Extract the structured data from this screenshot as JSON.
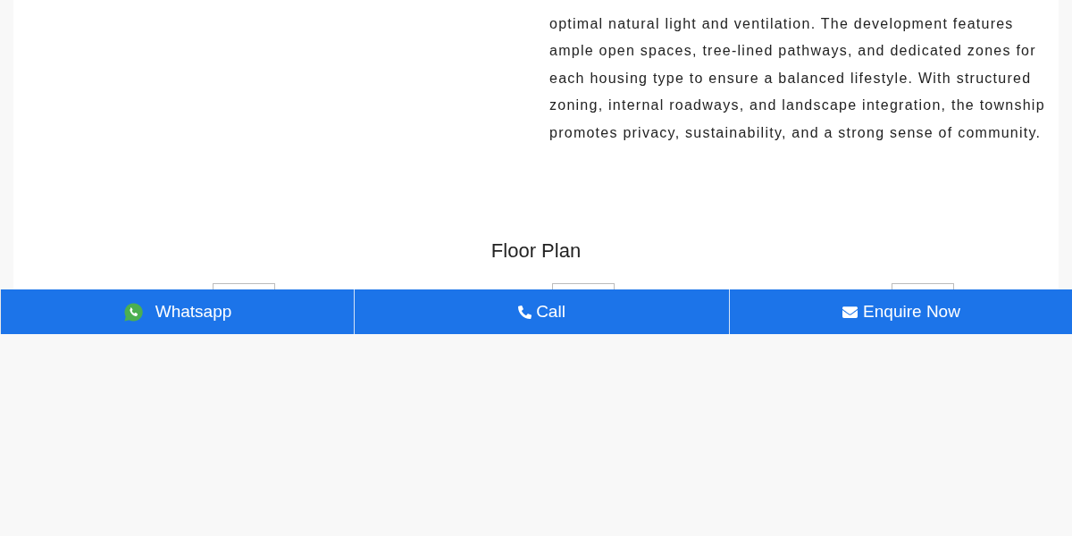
{
  "description": {
    "paragraph": "optimal natural light and ventilation. The development features ample open spaces, tree-lined pathways, and dedicated zones for each housing type to ensure a balanced lifestyle. With structured zoning, internal roadways, and landscape integration, the township promotes privacy, sustainability, and a strong sense of community."
  },
  "floor_plan": {
    "title": "Floor Plan"
  },
  "action_bar": {
    "buttons": [
      {
        "kind": "whatsapp",
        "label": "Whatsapp"
      },
      {
        "kind": "call",
        "label": "Call"
      },
      {
        "kind": "enquire",
        "label": "Enquire Now"
      }
    ]
  }
}
